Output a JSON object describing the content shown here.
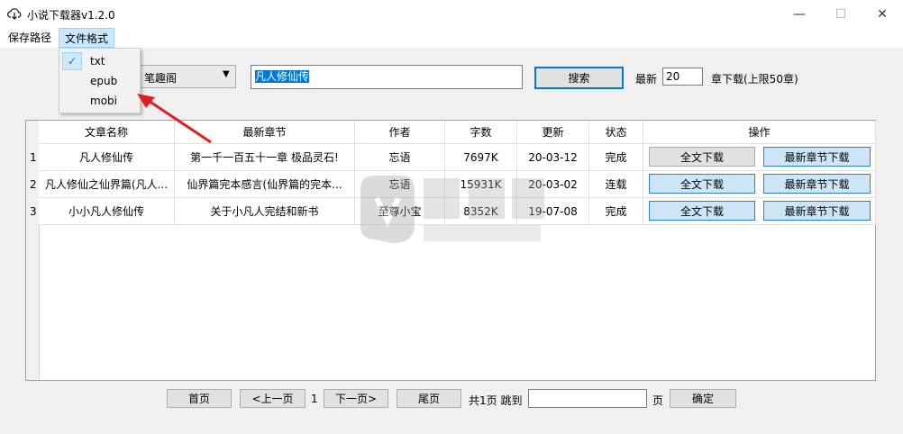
{
  "window": {
    "title": "小说下载器v1.2.0",
    "minimize_glyph": "—",
    "maximize_glyph": "☐",
    "close_glyph": "✕"
  },
  "menu": {
    "items": [
      {
        "label": "保存路径"
      },
      {
        "label": "文件格式"
      }
    ],
    "format_options": [
      {
        "label": "txt",
        "checked": true
      },
      {
        "label": "epub"
      },
      {
        "label": "mobi"
      }
    ],
    "check_glyph": "✓"
  },
  "search": {
    "source": "笔趣阁",
    "query": "凡人修仙传",
    "button_label": "搜索",
    "latest_label": "最新",
    "latest_count": "20",
    "chapters_label": "章下载(上限50章)"
  },
  "table": {
    "headers": [
      "文章名称",
      "最新章节",
      "作者",
      "字数",
      "更新",
      "状态",
      "操作"
    ],
    "rows": [
      {
        "num": "1",
        "title": "凡人修仙传",
        "latest": "第一千一百五十一章 极品灵石!",
        "author": "忘语",
        "words": "7697K",
        "updated": "20-03-12",
        "status": "完成"
      },
      {
        "num": "2",
        "title": "凡人修仙之仙界篇(凡人...",
        "latest": "仙界篇完本感言(仙界篇的完本...",
        "author": "忘语",
        "words": "15931K",
        "updated": "20-03-02",
        "status": "连载"
      },
      {
        "num": "3",
        "title": "小小凡人修仙传",
        "latest": "关于小凡人完结和新书",
        "author": "至尊小宝",
        "words": "8352K",
        "updated": "19-07-08",
        "status": "完成"
      }
    ],
    "full_download_label": "全文下载",
    "latest_download_label": "最新章节下载"
  },
  "pagination": {
    "first": "首页",
    "prev": "<上一页",
    "current": "1",
    "next": "下一页>",
    "last": "尾页",
    "total": "共1页 跳到",
    "page_unit": "页",
    "confirm": "确定"
  },
  "colors": {
    "accent": "#0078d7",
    "highlight": "#cce8ff",
    "arrow": "#e02020"
  }
}
